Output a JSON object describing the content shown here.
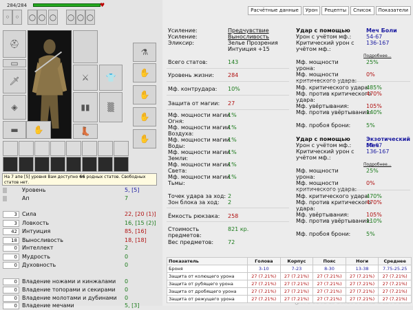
{
  "hp": {
    "text": "284/284",
    "fraction": 1.0
  },
  "tooltip": {
    "text_a": "На 7 апе [5] уровня Вам доступно ",
    "bold": "66",
    "text_b": " родных статов. Свободных статов нет."
  },
  "stats": [
    {
      "box": "",
      "name": "Уровень",
      "value": "5, [5]",
      "cls": "blue"
    },
    {
      "box": "",
      "name": "Ап",
      "value": "7",
      "cls": "green"
    },
    {
      "box": "3",
      "name": "Сила",
      "value": "22, [20 (1)]",
      "cls": "red"
    },
    {
      "box": "3",
      "name": "Ловкость",
      "value": "16, [15 (2)]",
      "cls": "green"
    },
    {
      "box": "42",
      "name": "Интуиция",
      "value": "85, [16]",
      "cls": "red"
    },
    {
      "box": "18",
      "name": "Выносливость",
      "value": "18, [18]",
      "cls": "red"
    },
    {
      "box": "0",
      "name": "Интеллект",
      "value": "2",
      "cls": "green"
    },
    {
      "box": "0",
      "name": "Мудрость",
      "value": "0",
      "cls": "green"
    },
    {
      "box": "0",
      "name": "Духовность",
      "value": "0",
      "cls": "green"
    },
    {
      "box": "0",
      "name": "Владение ножами и кинжалами",
      "value": "0",
      "cls": "green"
    },
    {
      "box": "0",
      "name": "Владение топорами и секирами",
      "value": "0",
      "cls": "green"
    },
    {
      "box": "0",
      "name": "Владение молотами и дубинами",
      "value": "0",
      "cls": "green"
    },
    {
      "box": "0",
      "name": "Владение мечами",
      "value": "5, [3]",
      "cls": "green"
    }
  ],
  "tabs": [
    "Расчётные данные",
    "Урон",
    "Рецепты",
    "Список",
    "Показатели"
  ],
  "info": {
    "boost1_label": "Усиление:",
    "boost1_value": "Предчувствие",
    "boost2_label": "Усиление:",
    "boost2_value": "Выносливость",
    "elixir_label": "Эликсир:",
    "elixir_value": "Зелье Прозрения",
    "elixir_sub": "Интуиция +15",
    "rows": [
      {
        "label": "Всего статов:",
        "value": "143",
        "cls": "green"
      },
      {
        "label": "Уровень жизни:",
        "value": "284",
        "cls": "red"
      },
      {
        "label": "Мф. контрудара:",
        "value": "10%",
        "cls": "green"
      },
      {
        "label": "Защита от магии:",
        "value": "27",
        "cls": "red"
      }
    ],
    "magic": [
      {
        "l1": "Мф. мощности магии",
        "l2": "Огня:",
        "value": "1%"
      },
      {
        "l1": "Мф. мощности магии",
        "l2": "Воздуха:",
        "value": "1%"
      },
      {
        "l1": "Мф. мощности магии",
        "l2": "Воды:",
        "value": "1%"
      },
      {
        "l1": "Мф. мощности магии",
        "l2": "Земли:",
        "value": "1%"
      },
      {
        "l1": "Мф. мощности магии",
        "l2": "Света:",
        "value": "1%"
      },
      {
        "l1": "Мф. мощности магии",
        "l2": "Тьмы:",
        "value": "1%"
      }
    ],
    "hit_points_label": "Точек удара за ход:",
    "hit_points_value": "2",
    "block_label": "Зон блока за ход:",
    "block_value": "2",
    "bag_label": "Ёмкость рюкзака:",
    "bag_value": "258",
    "cost_label1": "Стоимость",
    "cost_label2": "предметов:",
    "cost_value": "821 кр.",
    "weight_label": "Вес предметов:",
    "weight_value": "72"
  },
  "weapons": [
    {
      "header": "Удар с помощью",
      "name": "Меч Боли",
      "dmg_label": "Урон с учётом мф.:",
      "dmg": "54-67",
      "crit_label1": "Критический урон с",
      "crit_label2": "учётом мф.:",
      "crit": "136-167",
      "more": "Подробнее...",
      "power_label1": "Мф. мощности",
      "power_label2": "урона:",
      "power": "25%",
      "cpower_label1": "Мф. мощности",
      "cpower_label2": "критического удара:",
      "cpower": "0%",
      "crit_mf_label": "Мф. критического удара:",
      "crit_mf": "485%",
      "anticrit_label1": "Мф. против критического",
      "anticrit_label2": "удара:",
      "anticrit": "470%",
      "dodge_label": "Мф. увёртывания:",
      "dodge": "105%",
      "antidodge_label": "Мф. против увёртывания:",
      "antidodge": "140%",
      "armor_label": "Мф. пробоя брони:",
      "armor": "5%"
    },
    {
      "header": "Удар с помощью",
      "name": "Экзотический Меч",
      "dmg_label": "Урон с учётом мф.:",
      "dmg": "54-67",
      "crit_label1": "Критический урон с",
      "crit_label2": "учётом мф.:",
      "crit": "136-167",
      "more": "Подробнее...",
      "power_label1": "Мф. мощности",
      "power_label2": "урона:",
      "power": "25%",
      "cpower_label1": "Мф. мощности",
      "cpower_label2": "критического удара:",
      "cpower": "0%",
      "crit_mf_label": "Мф. критического удара:",
      "crit_mf": "470%",
      "anticrit_label1": "Мф. против критического",
      "anticrit_label2": "удара:",
      "anticrit": "470%",
      "dodge_label": "Мф. увёртывания:",
      "dodge": "105%",
      "antidodge_label": "Мф. против увёртывания:",
      "antidodge": "110%",
      "armor_label": "Мф. пробоя брони:",
      "armor": "5%"
    }
  ],
  "table": {
    "headers": [
      "Показатель",
      "Голова",
      "Корпус",
      "Пояс",
      "Ноги",
      "Среднее"
    ],
    "rows": [
      [
        "Броня",
        "3-10",
        "7-23",
        "8-30",
        "13-38",
        "7.75-25.25"
      ],
      [
        "Защита от колющего урона",
        "27 (7.21%)",
        "27 (7.21%)",
        "27 (7.21%)",
        "27 (7.21%)",
        "27 (7.21%)"
      ],
      [
        "Защита от рубящего урона",
        "27 (7.21%)",
        "27 (7.21%)",
        "27 (7.21%)",
        "27 (7.21%)",
        "27 (7.21%)"
      ],
      [
        "Защита от дробящего урона",
        "27 (7.21%)",
        "27 (7.21%)",
        "27 (7.21%)",
        "27 (7.21%)",
        "27 (7.21%)"
      ],
      [
        "Защита от режущего урона",
        "27 (7.21%)",
        "27 (7.21%)",
        "27 (7.21%)",
        "27 (7.21%)",
        "27 (7.21%)"
      ]
    ]
  },
  "watermark": "photo.scrolls.combats.com"
}
